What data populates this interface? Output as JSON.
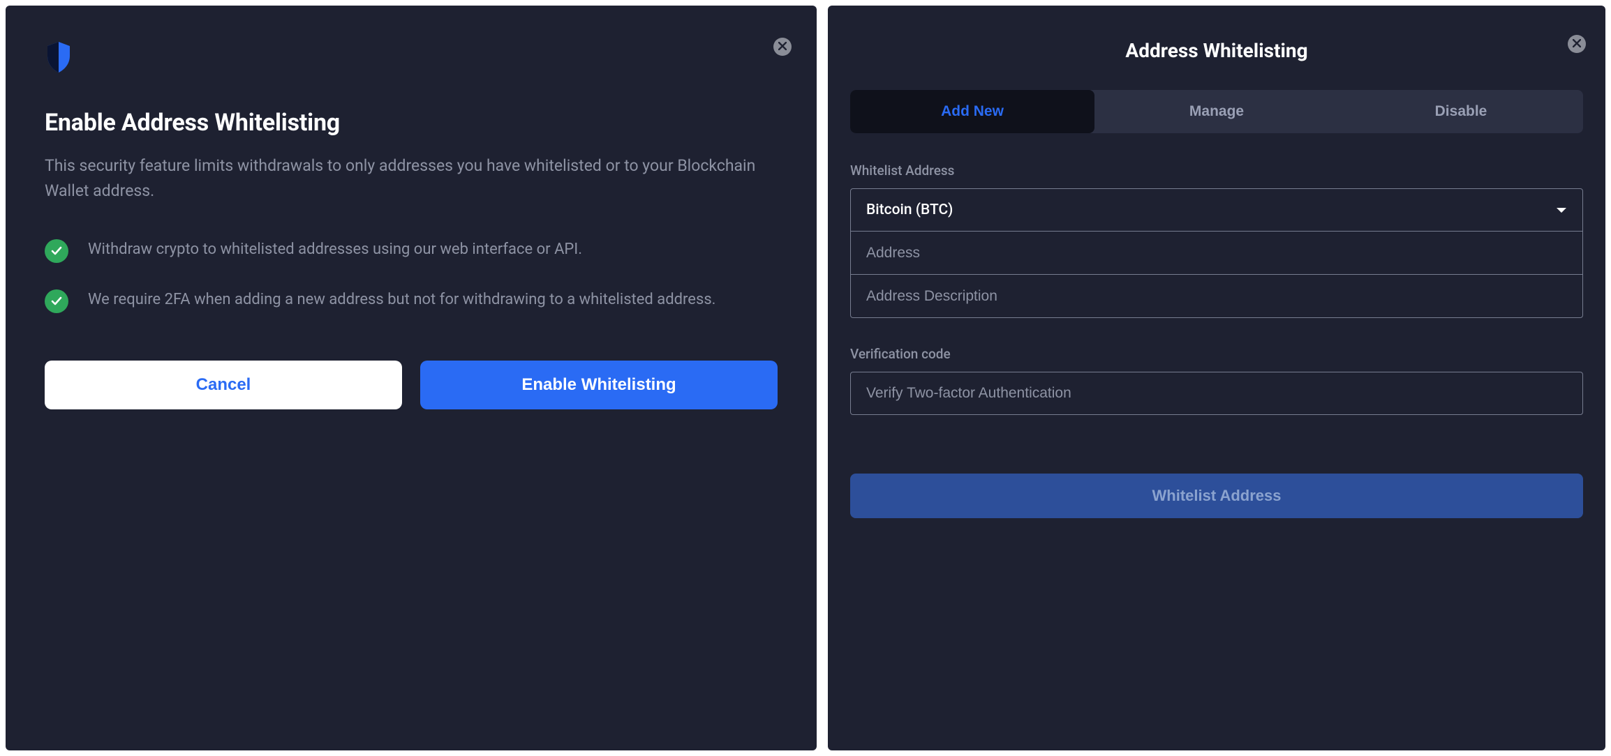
{
  "left": {
    "title": "Enable Address Whitelisting",
    "subtitle": "This security feature limits withdrawals to only addresses you have whitelisted or to your Blockchain Wallet address.",
    "bullets": [
      "Withdraw crypto to whitelisted addresses using our web interface or API.",
      "We require 2FA when adding a new address but not for withdrawing to a whitelisted address."
    ],
    "cancel_label": "Cancel",
    "enable_label": "Enable Whitelisting"
  },
  "right": {
    "title": "Address Whitelisting",
    "tabs": [
      {
        "label": "Add New",
        "active": true
      },
      {
        "label": "Manage",
        "active": false
      },
      {
        "label": "Disable",
        "active": false
      }
    ],
    "whitelist_label": "Whitelist Address",
    "asset_selected": "Bitcoin (BTC)",
    "address_placeholder": "Address",
    "description_placeholder": "Address Description",
    "verification_label": "Verification code",
    "verification_placeholder": "Verify Two-factor Authentication",
    "submit_label": "Whitelist Address"
  },
  "colors": {
    "accent": "#2a6bf4",
    "success": "#2fa85b",
    "panel_bg": "#1e2131"
  }
}
